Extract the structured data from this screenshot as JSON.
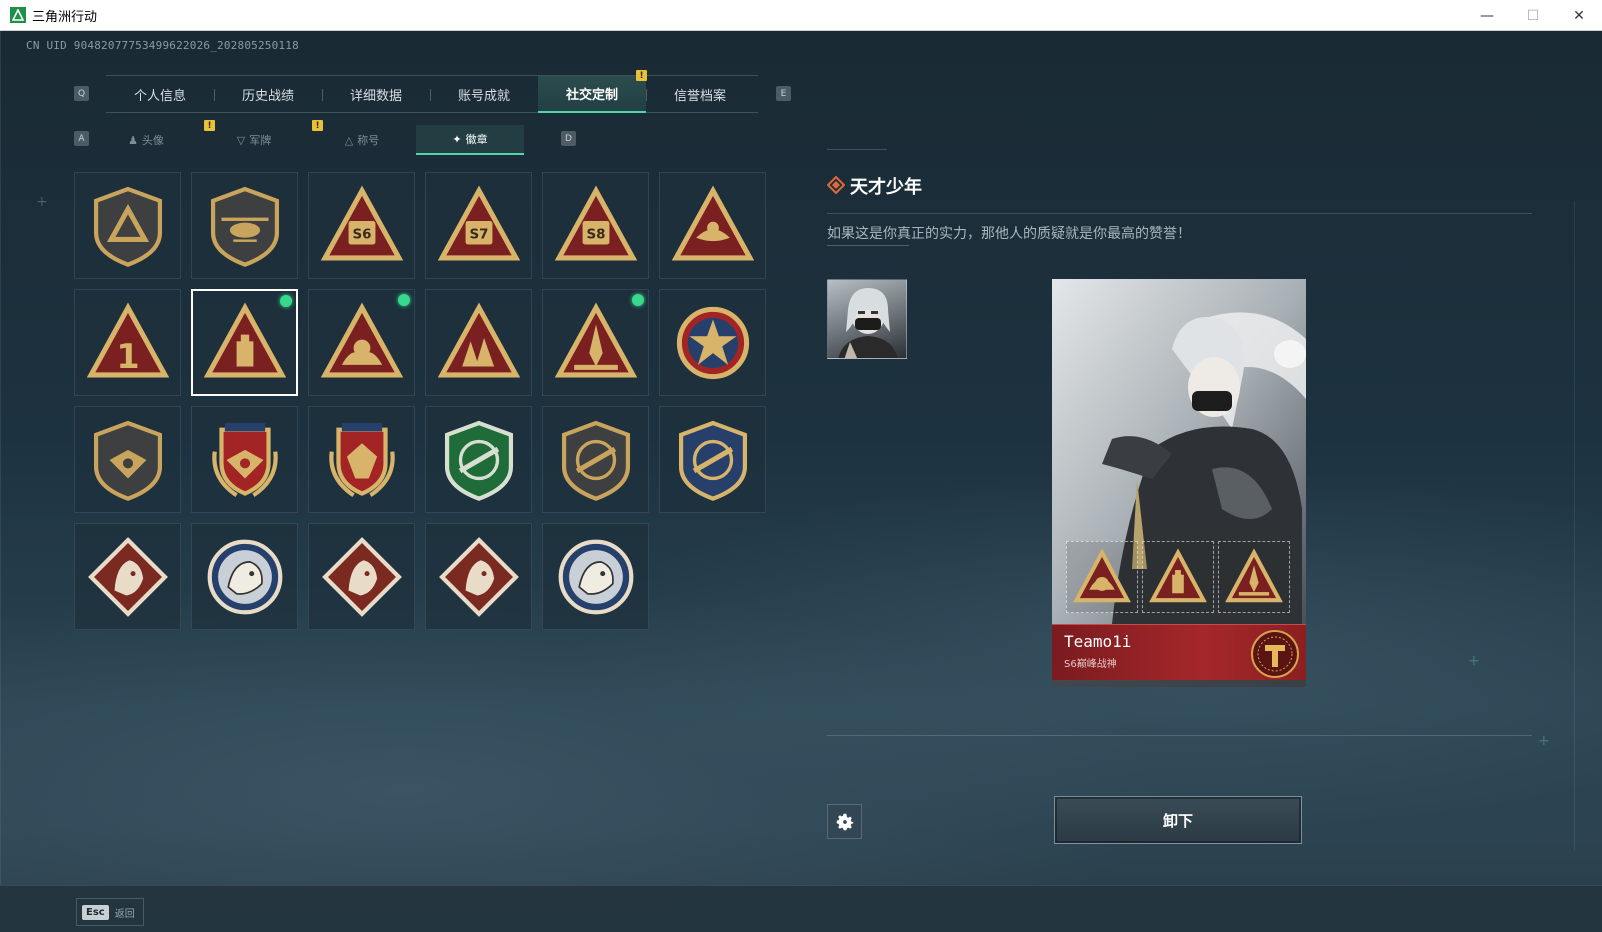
{
  "window": {
    "title": "三角洲行动",
    "minimize": "—",
    "maximize": "☐",
    "close": "✕"
  },
  "uid": "CN UID 90482077753499622026_202805250118",
  "tabs": {
    "prev_key": "Q",
    "next_key": "E",
    "items": [
      {
        "label": "个人信息"
      },
      {
        "label": "历史战绩"
      },
      {
        "label": "详细数据"
      },
      {
        "label": "账号成就"
      },
      {
        "label": "社交定制",
        "active": true,
        "notify": "!"
      },
      {
        "label": "信誉档案"
      }
    ]
  },
  "subtabs": {
    "prev_key": "A",
    "next_key": "D",
    "items": [
      {
        "label": "头像",
        "icon": "person-icon",
        "notify": "!"
      },
      {
        "label": "军牌",
        "icon": "dogtag-icon",
        "notify": "!"
      },
      {
        "label": "称号",
        "icon": "title-icon"
      },
      {
        "label": "徽章",
        "icon": "badge-icon",
        "active": true
      }
    ]
  },
  "badges": [
    {
      "name": "shield-triangle-badge",
      "shape": "shield",
      "motif": "triangle",
      "colors": [
        "#3d3f40",
        "#c9a45c"
      ]
    },
    {
      "name": "helicopter-badge",
      "shape": "shield",
      "motif": "helicopter",
      "colors": [
        "#3d3f40",
        "#c9a45c"
      ]
    },
    {
      "name": "s6-season-badge",
      "shape": "triangle",
      "motif": "S6",
      "colors": [
        "#7a2020",
        "#d7b46a"
      ]
    },
    {
      "name": "s7-season-badge",
      "shape": "triangle",
      "motif": "S7",
      "colors": [
        "#7a2020",
        "#d7b46a"
      ]
    },
    {
      "name": "s8-season-badge",
      "shape": "triangle",
      "motif": "S8",
      "colors": [
        "#7a2020",
        "#d7b46a"
      ]
    },
    {
      "name": "eagle-triangle-badge",
      "shape": "triangle",
      "motif": "bird",
      "colors": [
        "#7a2020",
        "#d7b46a"
      ]
    },
    {
      "name": "rank-one-badge",
      "shape": "triangle",
      "motif": "1",
      "colors": [
        "#7a2020",
        "#d7b46a"
      ]
    },
    {
      "name": "tower-badge",
      "shape": "triangle",
      "motif": "tower",
      "selected": true,
      "new": true,
      "colors": [
        "#7a2020",
        "#d7b46a"
      ]
    },
    {
      "name": "hands-gem-badge",
      "shape": "triangle",
      "motif": "hands",
      "new": true,
      "colors": [
        "#7a2020",
        "#d7b46a"
      ]
    },
    {
      "name": "soldiers-badge",
      "shape": "triangle",
      "motif": "soldiers",
      "colors": [
        "#7a2020",
        "#d7b46a"
      ]
    },
    {
      "name": "rocket-badge",
      "shape": "triangle",
      "motif": "rocket",
      "new": true,
      "colors": [
        "#7a2020",
        "#d7b46a"
      ]
    },
    {
      "name": "star-medal-badge",
      "shape": "round",
      "motif": "star",
      "colors": [
        "#a22424",
        "#d7b46a"
      ]
    },
    {
      "name": "wings-shield-badge",
      "shape": "shield",
      "motif": "wings",
      "colors": [
        "#3d3f40",
        "#c9a45c"
      ]
    },
    {
      "name": "laurel-shield-badge",
      "shape": "laurel",
      "motif": "wings",
      "colors": [
        "#a22424",
        "#d7b46a"
      ]
    },
    {
      "name": "laurel-gem-badge",
      "shape": "laurel",
      "motif": "gem",
      "colors": [
        "#a22424",
        "#d7b46a"
      ]
    },
    {
      "name": "rifle-green-badge",
      "shape": "shield",
      "motif": "rifle",
      "colors": [
        "#1f6b3a",
        "#d7e0d0"
      ]
    },
    {
      "name": "rifle-dark-badge",
      "shape": "shield",
      "motif": "rifle",
      "colors": [
        "#3d3f40",
        "#c9a45c"
      ]
    },
    {
      "name": "rifle-blue-badge",
      "shape": "shield",
      "motif": "rifle",
      "colors": [
        "#27406b",
        "#d7b46a"
      ]
    },
    {
      "name": "wolf-badge",
      "shape": "diamond",
      "motif": "wolf",
      "colors": [
        "#7a2a20",
        "#e8dcc8"
      ]
    },
    {
      "name": "eagle-round-badge",
      "shape": "circle",
      "motif": "eagle",
      "colors": [
        "#24406b",
        "#e8dcc8"
      ]
    },
    {
      "name": "dragon-badge",
      "shape": "diamond",
      "motif": "dragon",
      "colors": [
        "#7a2a20",
        "#e8dcc8"
      ]
    },
    {
      "name": "runner-badge",
      "shape": "diamond",
      "motif": "runner",
      "colors": [
        "#7a2a20",
        "#e8dcc8"
      ]
    },
    {
      "name": "lynx-badge",
      "shape": "circle",
      "motif": "lynx",
      "colors": [
        "#24406b",
        "#e8dcc8"
      ]
    }
  ],
  "detail": {
    "title": "天才少年",
    "description": "如果这是你真正的实力，那他人的质疑就是你最高的赞誉！"
  },
  "card": {
    "player_name": "Teamo1i",
    "rank": "S6巅峰战神"
  },
  "actions": {
    "settings_icon": "gear-icon",
    "unequip": "卸下"
  },
  "footer": {
    "esc_key": "Esc",
    "esc_label": "返回"
  },
  "colors": {
    "accent": "#4fd6a8",
    "notify": "#e8c13a",
    "new_dot": "#37d98c",
    "nameplate": "#a5272a"
  }
}
